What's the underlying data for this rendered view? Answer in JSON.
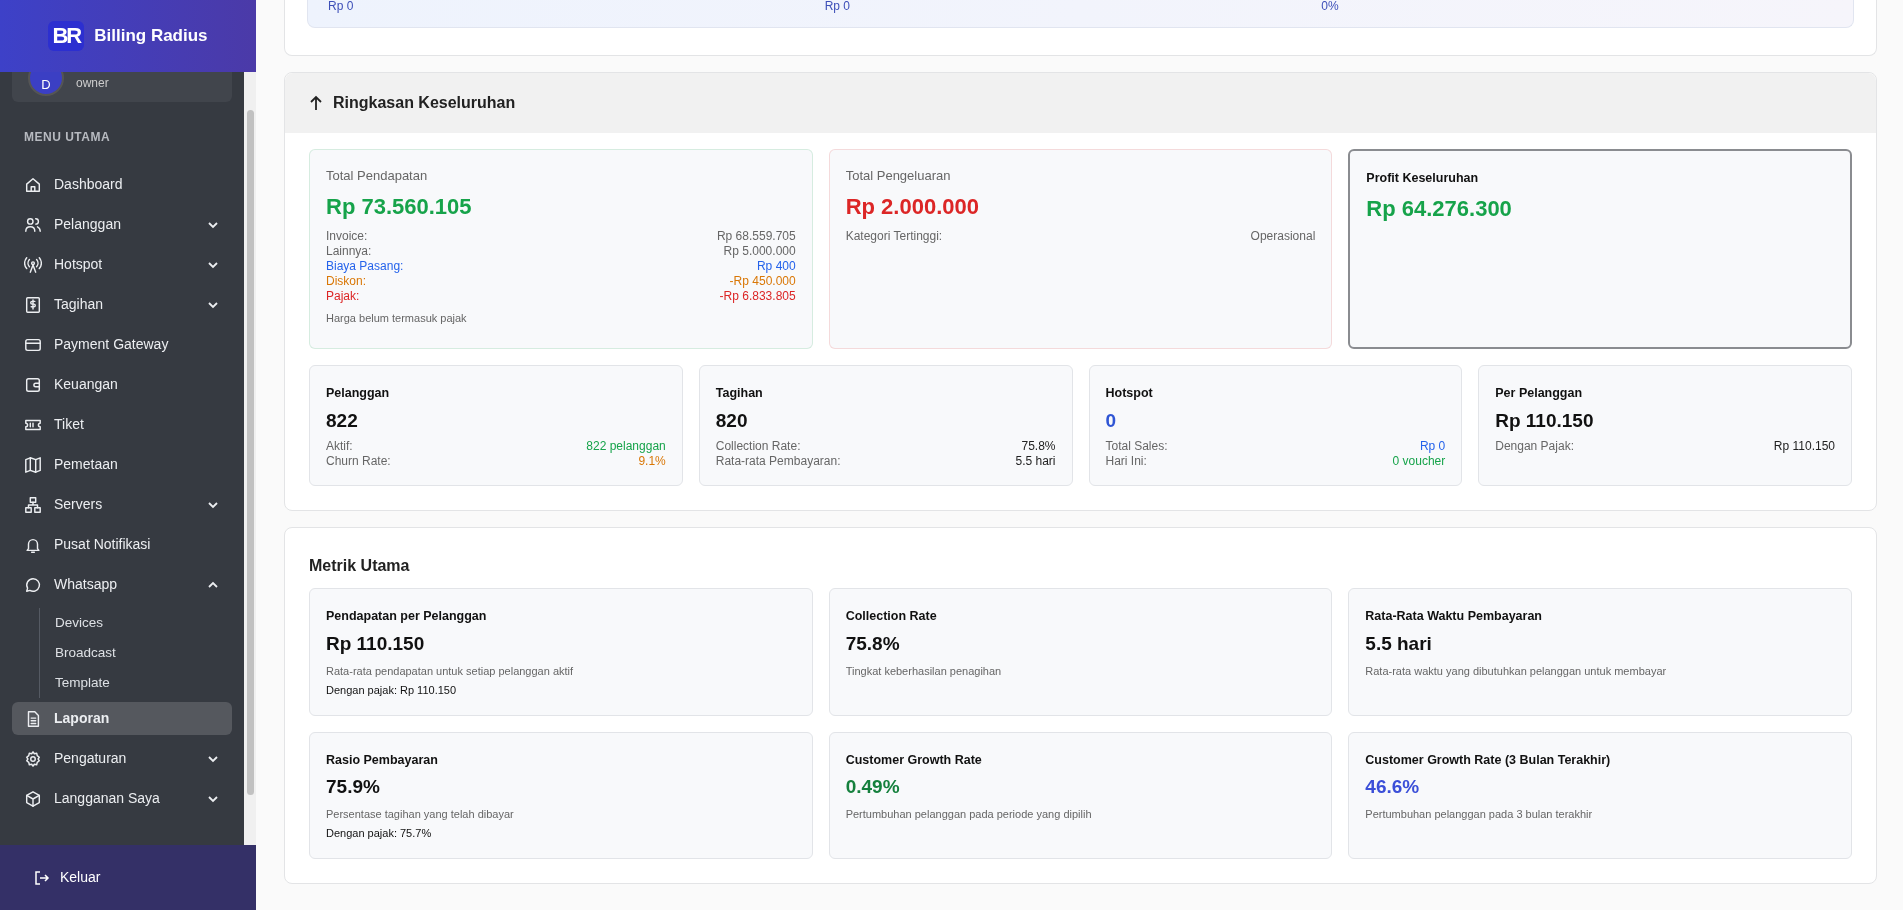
{
  "brand": {
    "logo": "BR",
    "name": "Billing Radius"
  },
  "user": {
    "avatar": "D",
    "role": "owner"
  },
  "menu_heading": "MENU UTAMA",
  "menu": [
    {
      "label": "Dashboard",
      "selected": false
    },
    {
      "label": "Pelanggan",
      "selected": false,
      "expanded": false
    },
    {
      "label": "Hotspot",
      "selected": false,
      "expanded": false
    },
    {
      "label": "Tagihan",
      "selected": false,
      "expanded": false
    },
    {
      "label": "Payment Gateway",
      "selected": false
    },
    {
      "label": "Keuangan",
      "selected": false
    },
    {
      "label": "Tiket",
      "selected": false
    },
    {
      "label": "Pemetaan",
      "selected": false
    },
    {
      "label": "Servers",
      "selected": false,
      "expanded": false
    },
    {
      "label": "Pusat Notifikasi",
      "selected": false
    },
    {
      "label": "Whatsapp",
      "selected": false,
      "expanded": true,
      "children": [
        {
          "label": "Devices"
        },
        {
          "label": "Broadcast"
        },
        {
          "label": "Template"
        }
      ]
    },
    {
      "label": "Laporan",
      "selected": true
    },
    {
      "label": "Pengaturan",
      "selected": false,
      "expanded": false
    },
    {
      "label": "Langganan Saya",
      "selected": false,
      "expanded": false
    }
  ],
  "logout": "Keluar",
  "top_card": {
    "row": [
      "Rp 0",
      "Rp 0",
      "0%"
    ]
  },
  "summary": {
    "title": "Ringkasan Keseluruhan",
    "main_cards": [
      {
        "title": "Total Pendapatan",
        "value": "Rp 73.560.105",
        "color": "#16a34a",
        "highlighted": false,
        "rows": [
          {
            "label": "Invoice:",
            "value": "Rp 68.559.705"
          },
          {
            "label": "Lainnya:",
            "value": "Rp 5.000.000"
          },
          {
            "label": "Biaya Pasang:",
            "value": "Rp 400",
            "color": "#2563eb"
          },
          {
            "label": "Diskon:",
            "value": "-Rp 450.000",
            "color": "#d97706"
          },
          {
            "label": "Pajak:",
            "value": "-Rp 6.833.805",
            "color": "#dc2626"
          }
        ],
        "note": "Harga belum termasuk pajak"
      },
      {
        "title": "Total Pengeluaran",
        "value": "Rp 2.000.000",
        "color": "#dc2626",
        "highlighted": false,
        "rows": [
          {
            "label": "Kategori Tertinggi:",
            "value": "Operasional"
          }
        ]
      },
      {
        "title": "Profit Keseluruhan",
        "value": "Rp 64.276.300",
        "color": "#16a34a",
        "highlighted": true
      }
    ],
    "stat_cards": [
      {
        "title": "Pelanggan",
        "value": "822",
        "color": "#111111",
        "rows": [
          {
            "label": "Aktif:",
            "value": "822 pelanggan",
            "color": "#16a34a"
          },
          {
            "label": "Churn Rate:",
            "value": "9.1%",
            "color": "#d97706"
          }
        ]
      },
      {
        "title": "Tagihan",
        "value": "820",
        "color": "#111111",
        "rows": [
          {
            "label": "Collection Rate:",
            "value": "75.8%"
          },
          {
            "label": "Rata-rata Pembayaran:",
            "value": "5.5 hari"
          }
        ]
      },
      {
        "title": "Hotspot",
        "value": "0",
        "color": "#2f55d4",
        "rows": [
          {
            "label": "Total Sales:",
            "value": "Rp 0",
            "color": "#2563eb"
          },
          {
            "label": "Hari Ini:",
            "value": "0 voucher",
            "color": "#16a34a"
          }
        ]
      },
      {
        "title": "Per Pelanggan",
        "value": "Rp 110.150",
        "color": "#111111",
        "rows": [
          {
            "label": "Dengan Pajak:",
            "value": "Rp 110.150"
          }
        ]
      }
    ]
  },
  "metrics": {
    "title": "Metrik Utama",
    "cards": [
      {
        "title": "Pendapatan per Pelanggan",
        "value": "Rp 110.150",
        "color": "#111111",
        "description": "Rata-rata pendapatan untuk setiap pelanggan aktif",
        "note": "Dengan pajak: Rp 110.150"
      },
      {
        "title": "Collection Rate",
        "value": "75.8%",
        "color": "#111111",
        "description": "Tingkat keberhasilan penagihan"
      },
      {
        "title": "Rata-Rata Waktu Pembayaran",
        "value": "5.5 hari",
        "color": "#111111",
        "description": "Rata-rata waktu yang dibutuhkan pelanggan untuk membayar"
      },
      {
        "title": "Rasio Pembayaran",
        "value": "75.9%",
        "color": "#111111",
        "description": "Persentase tagihan yang telah dibayar",
        "note": "Dengan pajak: 75.7%"
      },
      {
        "title": "Customer Growth Rate",
        "value": "0.49%",
        "color": "#15803d",
        "description": "Pertumbuhan pelanggan pada periode yang dipilih"
      },
      {
        "title": "Customer Growth Rate (3 Bulan Terakhir)",
        "value": "46.6%",
        "color": "#3b4fd8",
        "description": "Pertumbuhan pelanggan pada 3 bulan terakhir"
      }
    ]
  }
}
